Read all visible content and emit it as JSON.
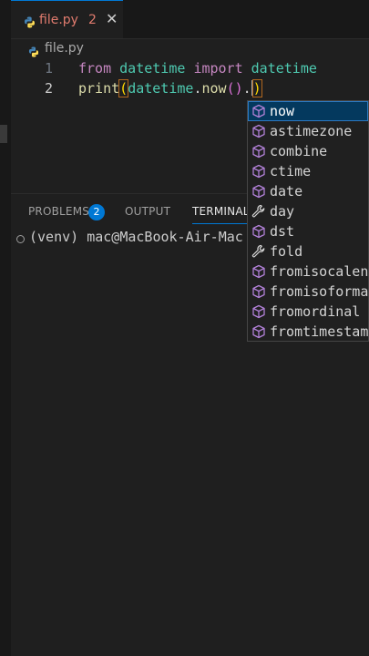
{
  "tab": {
    "title": "file.py",
    "problem_count": "2",
    "close": "✕"
  },
  "breadcrumb": {
    "file": "file.py"
  },
  "editor": {
    "lines": [
      {
        "number": "1",
        "tokens": [
          "from",
          " ",
          "datetime",
          " ",
          "import",
          " ",
          "datetime"
        ]
      },
      {
        "number": "2",
        "tokens": [
          "print",
          "(",
          "datetime",
          ".",
          "now",
          "()",
          ".",
          ")"
        ]
      }
    ]
  },
  "panel": {
    "tabs": [
      {
        "label": "PROBLEMS"
      },
      {
        "label": "OUTPUT"
      },
      {
        "label": "TERMINAL"
      }
    ],
    "problems_badge": "2",
    "terminal_line": "(venv) mac@MacBook-Air-Mac te"
  },
  "suggestions": {
    "items": [
      {
        "label": "now",
        "kind": "method-cube-icon"
      },
      {
        "label": "astimezone",
        "kind": "method-cube-icon"
      },
      {
        "label": "combine",
        "kind": "method-cube-icon"
      },
      {
        "label": "ctime",
        "kind": "method-cube-icon"
      },
      {
        "label": "date",
        "kind": "method-cube-icon"
      },
      {
        "label": "day",
        "kind": "property-wrench-icon"
      },
      {
        "label": "dst",
        "kind": "method-cube-icon"
      },
      {
        "label": "fold",
        "kind": "property-wrench-icon"
      },
      {
        "label": "fromisocalendar",
        "kind": "method-cube-icon"
      },
      {
        "label": "fromisoformat",
        "kind": "method-cube-icon"
      },
      {
        "label": "fromordinal",
        "kind": "method-cube-icon"
      },
      {
        "label": "fromtimestamp",
        "kind": "method-cube-icon"
      }
    ],
    "selected_index": 0
  },
  "colors": {
    "accent": "#0078d4",
    "error": "#e07b6e",
    "method_icon": "#b180d7",
    "selection": "#04395e"
  }
}
